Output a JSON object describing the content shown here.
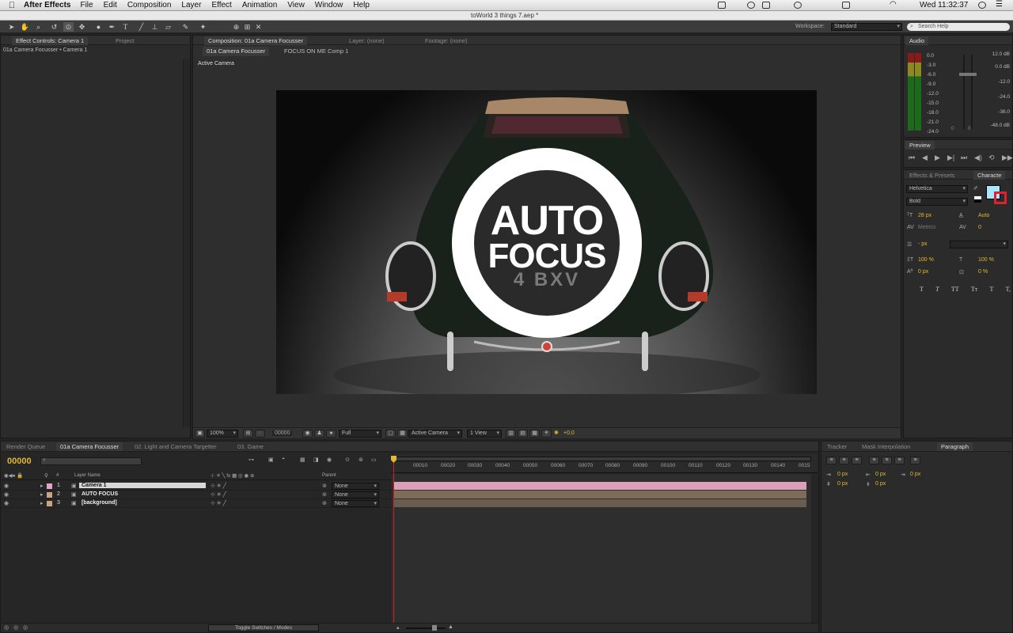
{
  "menubar": {
    "app": "After Effects",
    "items": [
      "File",
      "Edit",
      "Composition",
      "Layer",
      "Effect",
      "Animation",
      "View",
      "Window",
      "Help"
    ],
    "document_title": "toWorld 3 things 7.aep *",
    "clock": "Wed 11:32:37"
  },
  "toolbar": {
    "workspace_label": "Workspace:",
    "workspace_value": "Standard",
    "search_placeholder": "Search Help"
  },
  "effect_controls": {
    "tabs": [
      "Effect Controls: Camera 1",
      "Project"
    ],
    "breadcrumb": "01a Camera Focusser • Camera 1"
  },
  "composition": {
    "tabs": [
      "Composition: 01a Camera Focusser",
      "Layer: (none)",
      "Footage: (none)"
    ],
    "subtabs": [
      "01a Camera Focusser",
      "FOCUS ON ME Comp 1"
    ],
    "view_label": "Active Camera",
    "logo_line1": "AUTO",
    "logo_line2": "FOCUS",
    "plate_text": "4 BXV",
    "footer": {
      "zoom": "100%",
      "timecode": "00000",
      "resolution": "Full",
      "camera": "Active Camera",
      "views": "1 View",
      "exposure": "+0.0"
    }
  },
  "audio": {
    "title": "Audio",
    "left_scale": [
      "0.0",
      "-3.0",
      "-6.0",
      "-9.0",
      "-12.0",
      "-15.0",
      "-18.0",
      "-21.0",
      "-24.0"
    ],
    "right_scale": [
      "12.0 dB",
      "0.0 dB",
      "-12.0",
      "-24.0",
      "-36.0",
      "-48.0 dB"
    ],
    "slider_labels": [
      "0",
      "0"
    ]
  },
  "preview": {
    "title": "Preview"
  },
  "character": {
    "tabs": [
      "Effects & Presets",
      "Characte"
    ],
    "font_family": "Helvetica",
    "font_style": "Bold",
    "size": "28 px",
    "leading": "Auto",
    "kerning": "Metrics",
    "tracking": "0",
    "stroke_width": "- px",
    "vscale": "100 %",
    "hscale": "100 %",
    "baseline": "0 px",
    "tsume": "0 %",
    "fill_color": "#a8e8ff",
    "type_buttons": [
      "T",
      "T",
      "TT",
      "Tт",
      "T",
      "T,"
    ]
  },
  "timeline": {
    "tabs": [
      "Render Queue",
      "01a Camera Focusser",
      "02. Light and Camera Targetter",
      "03. Game"
    ],
    "timecode": "00000",
    "col_layer_name": "Layer Name",
    "col_parent": "Parent",
    "col_num": "#",
    "ruler": [
      "00010",
      "00020",
      "00030",
      "00040",
      "00050",
      "00060",
      "00070",
      "00080",
      "00090",
      "00100",
      "00110",
      "00120",
      "00130",
      "00140",
      "0015"
    ],
    "toggle_label": "Toggle Switches / Modes",
    "layers": [
      {
        "num": "1",
        "name": "Camera 1",
        "parent": "None",
        "label_color": "#e6a5c8",
        "bar_color": "#d9a0b8"
      },
      {
        "num": "2",
        "name": "AUTO FOCUS",
        "parent": "None",
        "label_color": "#c9a47c",
        "bar_color": "#7d6c5a"
      },
      {
        "num": "3",
        "name": "[background]",
        "parent": "None",
        "label_color": "#c9a47c",
        "bar_color": "#6a5d50"
      }
    ]
  },
  "right_bottom": {
    "tabs": [
      "Tracker",
      "Mask Interpolation",
      "Paragraph"
    ],
    "values": [
      "0 px",
      "0 px",
      "0 px",
      "0 px",
      "0 px"
    ]
  }
}
